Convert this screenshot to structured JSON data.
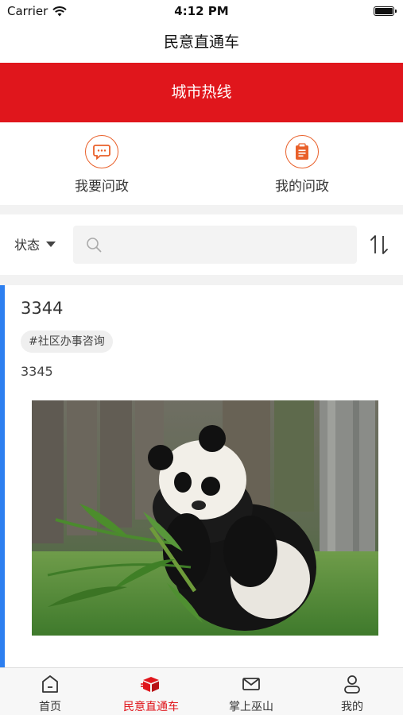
{
  "status_bar": {
    "carrier": "Carrier",
    "time": "4:12 PM"
  },
  "nav": {
    "title": "民意直通车"
  },
  "banner": {
    "title": "城市热线"
  },
  "actions": [
    {
      "label": "我要问政",
      "icon": "message-icon"
    },
    {
      "label": "我的问政",
      "icon": "clipboard-icon"
    }
  ],
  "filter": {
    "status_label": "状态",
    "search_placeholder": ""
  },
  "card": {
    "title": "3344",
    "tag": "#社区办事咨询",
    "content": "3345",
    "image": "panda-eating-bamboo"
  },
  "tabs": [
    {
      "label": "首页",
      "icon": "home-icon",
      "active": false
    },
    {
      "label": "民意直通车",
      "icon": "box-icon",
      "active": true
    },
    {
      "label": "掌上巫山",
      "icon": "mail-icon",
      "active": false
    },
    {
      "label": "我的",
      "icon": "user-icon",
      "active": false
    }
  ],
  "colors": {
    "brand_red": "#e0161c",
    "accent_orange": "#e9602a",
    "accent_blue": "#2d7ff0"
  }
}
